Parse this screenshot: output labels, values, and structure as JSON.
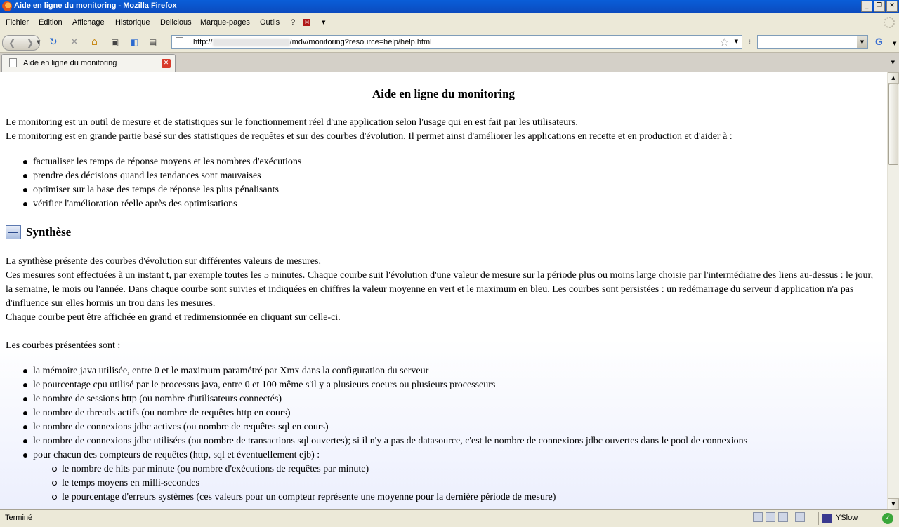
{
  "window": {
    "title": "Aide en ligne du monitoring - Mozilla Firefox"
  },
  "menu": {
    "items": [
      "Fichier",
      "Édition",
      "Affichage",
      "Historique",
      "Delicious",
      "Marque-pages",
      "Outils",
      "?"
    ],
    "extra_icon": "mh-icon"
  },
  "navbar": {
    "url_prefix": "http://",
    "url_suffix": "/mdv/monitoring?resource=help/help.html",
    "search_value": ""
  },
  "tabs": [
    {
      "label": "Aide en ligne du monitoring"
    }
  ],
  "content": {
    "title": "Aide en ligne du monitoring",
    "intro": [
      "Le monitoring est un outil de mesure et de statistiques sur le fonctionnement réel d'une application selon l'usage qui en est fait par les utilisateurs.",
      "Le monitoring est en grande partie basé sur des statistiques de requêtes et sur des courbes d'évolution. Il permet ainsi d'améliorer les applications en recette et en production et d'aider à :"
    ],
    "goals": [
      "factualiser les temps de réponse moyens et les nombres d'exécutions",
      "prendre des décisions quand les tendances sont mauvaises",
      "optimiser sur la base des temps de réponse les plus pénalisants",
      "vérifier l'amélioration réelle après des optimisations"
    ],
    "section_title": "Synthèse",
    "synthese": [
      "La synthèse présente des courbes d'évolution sur différentes valeurs de mesures.",
      "Ces mesures sont effectuées à un instant t, par exemple toutes les 5 minutes. Chaque courbe suit l'évolution d'une valeur de mesure sur la période plus ou moins large choisie par l'intermédiaire des liens au-dessus : le jour, la semaine, le mois ou l'année. Dans chaque courbe sont suivies et indiquées en chiffres la valeur moyenne en vert et le maximum en bleu. Les courbes sont persistées : un redémarrage du serveur d'application n'a pas d'influence sur elles hormis un trou dans les mesures.",
      "Chaque courbe peut être affichée en grand et redimensionnée en cliquant sur celle-ci."
    ],
    "courbes_intro": "Les courbes présentées sont :",
    "courbes": [
      "la mémoire java utilisée, entre 0 et le maximum paramétré par Xmx dans la configuration du serveur",
      "le pourcentage cpu utilisé par le processus java, entre 0 et 100 même s'il y a plusieurs coeurs ou plusieurs processeurs",
      "le nombre de sessions http (ou nombre d'utilisateurs connectés)",
      "le nombre de threads actifs (ou nombre de requêtes http en cours)",
      "le nombre de connexions jdbc actives (ou nombre de requêtes sql en cours)",
      "le nombre de connexions jdbc utilisées (ou nombre de transactions sql ouvertes); si il n'y a pas de datasource, c'est le nombre de connexions jdbc ouvertes dans le pool de connexions",
      "pour chacun des compteurs de requêtes (http, sql et éventuellement ejb) :"
    ],
    "compteurs": [
      "le nombre de hits par minute (ou nombre d'exécutions de requêtes par minute)",
      "le temps moyens en milli-secondes",
      "le pourcentage d'erreurs systèmes (ces valeurs pour un compteur représente une moyenne pour la dernière période de mesure)"
    ]
  },
  "status": {
    "text": "Terminé",
    "yslow": "YSlow"
  }
}
